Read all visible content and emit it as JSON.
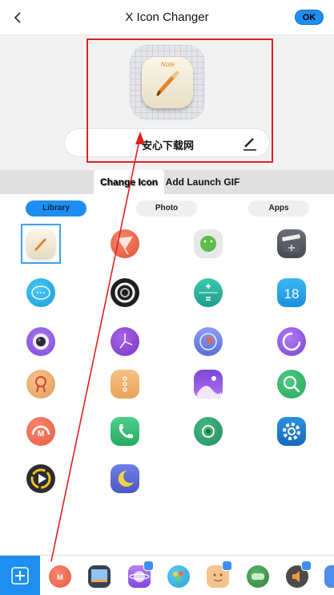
{
  "header": {
    "title": "X Icon Changer",
    "ok_label": "OK"
  },
  "preview": {
    "icon_label": "Note",
    "name": "安心下载网"
  },
  "tabs": [
    {
      "label": "Change Icon",
      "active": true
    },
    {
      "label": "Add Launch GIF",
      "active": false
    }
  ],
  "segments": [
    {
      "label": "Library",
      "active": true
    },
    {
      "label": "Photo",
      "active": false
    },
    {
      "label": "Apps",
      "active": false
    }
  ],
  "library_icons": [
    "note-icon",
    "kite-icon",
    "android-icon",
    "clapper-icon",
    "chat-icon",
    "camera-lens-icon",
    "calculator-icon",
    "calendar-icon",
    "webcam-icon",
    "clock-icon",
    "compass-icon",
    "browser-icon",
    "badge-icon",
    "dots-icon",
    "gallery-icon",
    "search-icon",
    "music-icon",
    "phone-icon",
    "record-icon",
    "settings-icon",
    "play-icon",
    "moon-icon"
  ],
  "calendar_day": "18",
  "dock_icons": [
    "music-icon",
    "photo-frame-icon",
    "planet-icon",
    "paint-icon",
    "face-icon",
    "game-icon",
    "speaker-icon",
    "partial-icon"
  ]
}
